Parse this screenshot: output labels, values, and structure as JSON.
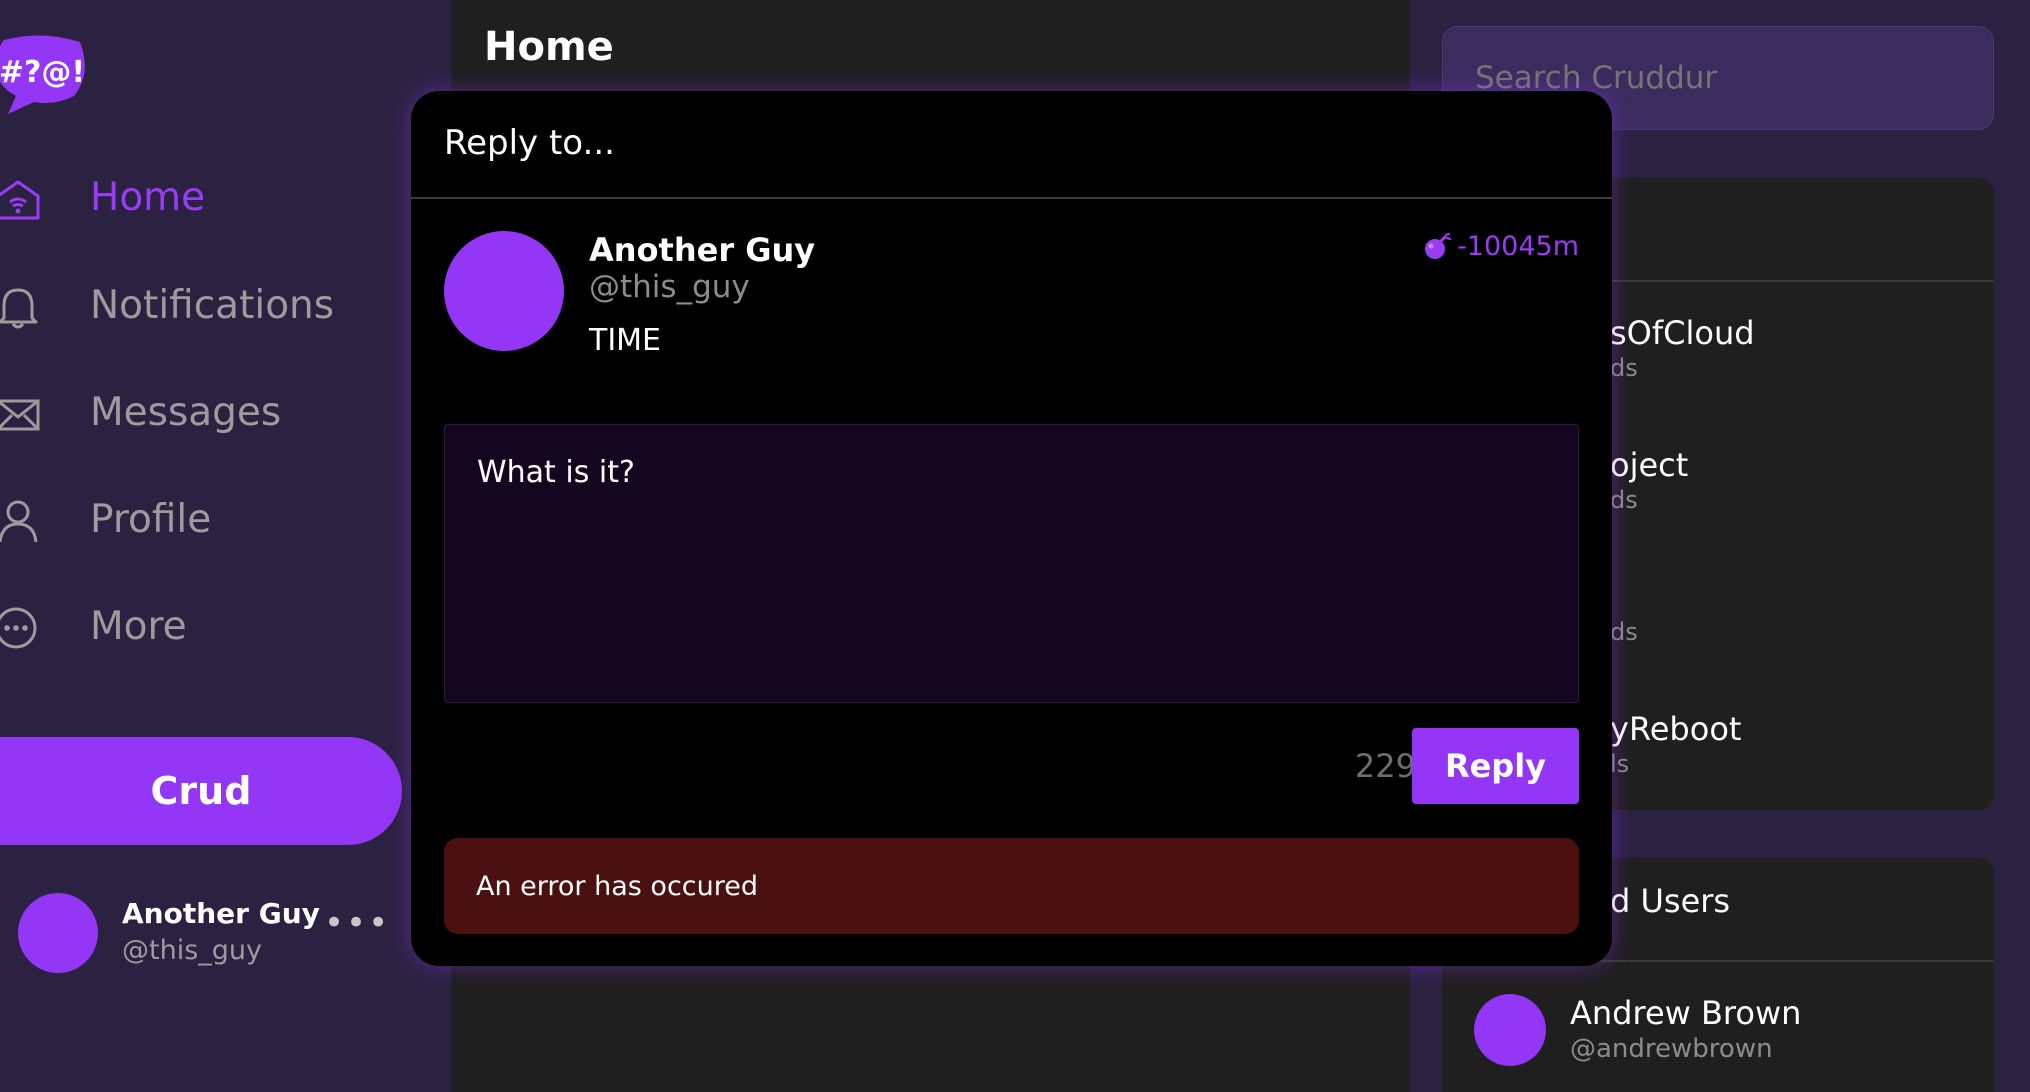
{
  "app": {
    "logo_text": "#?@!",
    "brand_color": "#9336f5",
    "nav": [
      {
        "label": "Home",
        "icon": "home-icon",
        "active": true
      },
      {
        "label": "Notifications",
        "icon": "bell-icon",
        "active": false
      },
      {
        "label": "Messages",
        "icon": "envelope-icon",
        "active": false
      },
      {
        "label": "Profile",
        "icon": "user-icon",
        "active": false
      },
      {
        "label": "More",
        "icon": "more-icon",
        "active": false
      }
    ],
    "crud_button": "Crud",
    "current_user": {
      "name": "Another Guy",
      "handle": "@this_guy",
      "menu": "•••"
    }
  },
  "feed": {
    "title": "Home"
  },
  "right": {
    "search_placeholder": "Search Cruddur",
    "trending": [
      {
        "name": "sOfCloud",
        "count": "ds"
      },
      {
        "name": "oject",
        "count": "ds"
      },
      {
        "name": "",
        "count": "ds"
      },
      {
        "name": "yReboot",
        "count": "ls"
      }
    ],
    "suggested_title": "d Users",
    "suggested": [
      {
        "name": "Andrew Brown",
        "handle": "@andrewbrown"
      }
    ]
  },
  "modal": {
    "title": "Reply to...",
    "post": {
      "name": "Another Guy",
      "handle": "@this_guy",
      "message": "TIME",
      "expires": "-10045m",
      "expires_icon": "bomb-icon"
    },
    "reply_text": "What is it?",
    "char_count": "229",
    "reply_button": "Reply",
    "error": "An error has occured"
  }
}
